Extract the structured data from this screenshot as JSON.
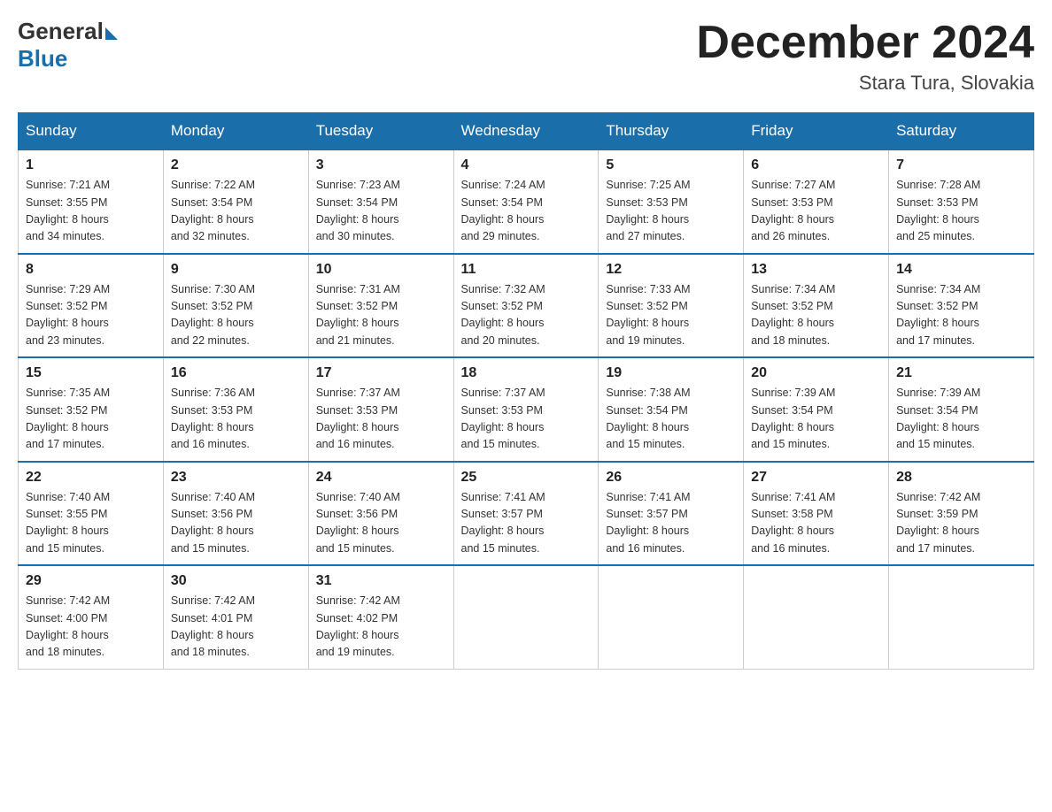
{
  "header": {
    "logo_general": "General",
    "logo_blue": "Blue",
    "title": "December 2024",
    "subtitle": "Stara Tura, Slovakia"
  },
  "weekdays": [
    "Sunday",
    "Monday",
    "Tuesday",
    "Wednesday",
    "Thursday",
    "Friday",
    "Saturday"
  ],
  "weeks": [
    [
      {
        "day": "1",
        "sunrise": "7:21 AM",
        "sunset": "3:55 PM",
        "daylight": "8 hours and 34 minutes."
      },
      {
        "day": "2",
        "sunrise": "7:22 AM",
        "sunset": "3:54 PM",
        "daylight": "8 hours and 32 minutes."
      },
      {
        "day": "3",
        "sunrise": "7:23 AM",
        "sunset": "3:54 PM",
        "daylight": "8 hours and 30 minutes."
      },
      {
        "day": "4",
        "sunrise": "7:24 AM",
        "sunset": "3:54 PM",
        "daylight": "8 hours and 29 minutes."
      },
      {
        "day": "5",
        "sunrise": "7:25 AM",
        "sunset": "3:53 PM",
        "daylight": "8 hours and 27 minutes."
      },
      {
        "day": "6",
        "sunrise": "7:27 AM",
        "sunset": "3:53 PM",
        "daylight": "8 hours and 26 minutes."
      },
      {
        "day": "7",
        "sunrise": "7:28 AM",
        "sunset": "3:53 PM",
        "daylight": "8 hours and 25 minutes."
      }
    ],
    [
      {
        "day": "8",
        "sunrise": "7:29 AM",
        "sunset": "3:52 PM",
        "daylight": "8 hours and 23 minutes."
      },
      {
        "day": "9",
        "sunrise": "7:30 AM",
        "sunset": "3:52 PM",
        "daylight": "8 hours and 22 minutes."
      },
      {
        "day": "10",
        "sunrise": "7:31 AM",
        "sunset": "3:52 PM",
        "daylight": "8 hours and 21 minutes."
      },
      {
        "day": "11",
        "sunrise": "7:32 AM",
        "sunset": "3:52 PM",
        "daylight": "8 hours and 20 minutes."
      },
      {
        "day": "12",
        "sunrise": "7:33 AM",
        "sunset": "3:52 PM",
        "daylight": "8 hours and 19 minutes."
      },
      {
        "day": "13",
        "sunrise": "7:34 AM",
        "sunset": "3:52 PM",
        "daylight": "8 hours and 18 minutes."
      },
      {
        "day": "14",
        "sunrise": "7:34 AM",
        "sunset": "3:52 PM",
        "daylight": "8 hours and 17 minutes."
      }
    ],
    [
      {
        "day": "15",
        "sunrise": "7:35 AM",
        "sunset": "3:52 PM",
        "daylight": "8 hours and 17 minutes."
      },
      {
        "day": "16",
        "sunrise": "7:36 AM",
        "sunset": "3:53 PM",
        "daylight": "8 hours and 16 minutes."
      },
      {
        "day": "17",
        "sunrise": "7:37 AM",
        "sunset": "3:53 PM",
        "daylight": "8 hours and 16 minutes."
      },
      {
        "day": "18",
        "sunrise": "7:37 AM",
        "sunset": "3:53 PM",
        "daylight": "8 hours and 15 minutes."
      },
      {
        "day": "19",
        "sunrise": "7:38 AM",
        "sunset": "3:54 PM",
        "daylight": "8 hours and 15 minutes."
      },
      {
        "day": "20",
        "sunrise": "7:39 AM",
        "sunset": "3:54 PM",
        "daylight": "8 hours and 15 minutes."
      },
      {
        "day": "21",
        "sunrise": "7:39 AM",
        "sunset": "3:54 PM",
        "daylight": "8 hours and 15 minutes."
      }
    ],
    [
      {
        "day": "22",
        "sunrise": "7:40 AM",
        "sunset": "3:55 PM",
        "daylight": "8 hours and 15 minutes."
      },
      {
        "day": "23",
        "sunrise": "7:40 AM",
        "sunset": "3:56 PM",
        "daylight": "8 hours and 15 minutes."
      },
      {
        "day": "24",
        "sunrise": "7:40 AM",
        "sunset": "3:56 PM",
        "daylight": "8 hours and 15 minutes."
      },
      {
        "day": "25",
        "sunrise": "7:41 AM",
        "sunset": "3:57 PM",
        "daylight": "8 hours and 15 minutes."
      },
      {
        "day": "26",
        "sunrise": "7:41 AM",
        "sunset": "3:57 PM",
        "daylight": "8 hours and 16 minutes."
      },
      {
        "day": "27",
        "sunrise": "7:41 AM",
        "sunset": "3:58 PM",
        "daylight": "8 hours and 16 minutes."
      },
      {
        "day": "28",
        "sunrise": "7:42 AM",
        "sunset": "3:59 PM",
        "daylight": "8 hours and 17 minutes."
      }
    ],
    [
      {
        "day": "29",
        "sunrise": "7:42 AM",
        "sunset": "4:00 PM",
        "daylight": "8 hours and 18 minutes."
      },
      {
        "day": "30",
        "sunrise": "7:42 AM",
        "sunset": "4:01 PM",
        "daylight": "8 hours and 18 minutes."
      },
      {
        "day": "31",
        "sunrise": "7:42 AM",
        "sunset": "4:02 PM",
        "daylight": "8 hours and 19 minutes."
      },
      null,
      null,
      null,
      null
    ]
  ],
  "labels": {
    "sunrise": "Sunrise:",
    "sunset": "Sunset:",
    "daylight": "Daylight:"
  }
}
